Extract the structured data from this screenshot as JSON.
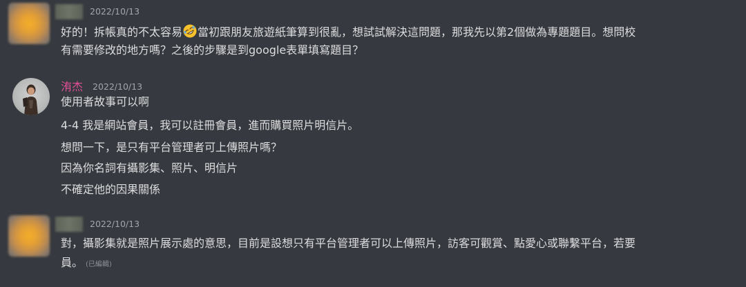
{
  "messages": [
    {
      "author": "",
      "timestamp": "2022/10/13",
      "lines": [
        {
          "before_emoji": "好的！拆帳真的不太容易",
          "emoji": "rolling-on-floor-laughing-emoji",
          "after_emoji": "當初跟朋友旅遊紙筆算到很亂，想試試解決這問題，那我先以第2個做為專題題目。想問校"
        },
        {
          "text": "有需要修改的地方嗎？之後的步驟是到google表單填寫題目？"
        }
      ]
    },
    {
      "author": "洧杰",
      "timestamp": "2022/10/13",
      "lines": [
        {
          "text": "使用者故事可以啊"
        },
        {
          "text": "4-4 我是網站會員，我可以註冊會員，進而購買照片明信片。"
        },
        {
          "text": "想問一下，是只有平台管理者可上傳照片嗎？"
        },
        {
          "text": "因為你名詞有攝影集、照片、明信片"
        },
        {
          "text": "不確定他的因果關係"
        }
      ]
    },
    {
      "author": "",
      "timestamp": "2022/10/13",
      "lines": [
        {
          "text": "對，攝影集就是照片展示處的意思，目前是設想只有平台管理者可以上傳照片，訪客可觀賞、點愛心或聯繫平台，若要"
        },
        {
          "text": "員。",
          "edited": "(已編輯)"
        }
      ]
    }
  ],
  "colors": {
    "background": "#36393f",
    "text": "#dcddde",
    "timestamp": "#a3a6aa",
    "author_name": "#e04f96"
  }
}
